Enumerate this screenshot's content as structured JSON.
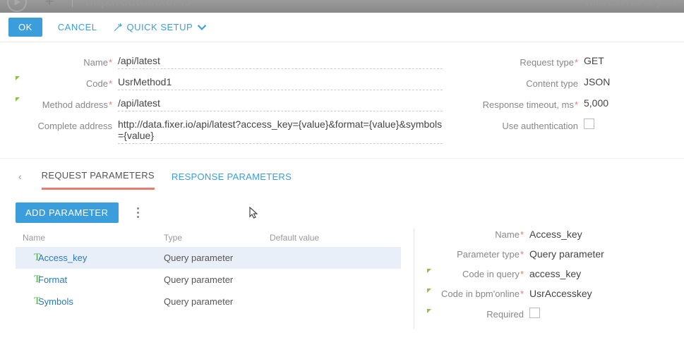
{
  "ribbon": {
    "url": "http://data.fixer.io",
    "search_placeholder": "What can I do for you?"
  },
  "toolbar": {
    "ok": "OK",
    "cancel": "CANCEL",
    "quick": "QUICK SETUP"
  },
  "form": {
    "labels": {
      "name": "Name",
      "code": "Code",
      "method_address": "Method address",
      "complete_address": "Complete address",
      "request_type": "Request type",
      "content_type": "Content type",
      "response_timeout": "Response timeout, ms",
      "use_auth": "Use authentication"
    },
    "values": {
      "name": "/api/latest",
      "code": "UsrMethod1",
      "method_address": "/api/latest",
      "complete_address": "http://data.fixer.io/api/latest?access_key={value}&format={value}&symbols={value}",
      "request_type": "GET",
      "content_type": "JSON",
      "response_timeout": "5,000"
    }
  },
  "tabs": {
    "request": "REQUEST PARAMETERS",
    "response": "RESPONSE PARAMETERS"
  },
  "params": {
    "add_button": "ADD PARAMETER",
    "columns": {
      "name": "Name",
      "type": "Type",
      "default": "Default value"
    },
    "rows": [
      {
        "name": "Access_key",
        "type": "Query parameter",
        "default": ""
      },
      {
        "name": "Format",
        "type": "Query parameter",
        "default": ""
      },
      {
        "name": "Symbols",
        "type": "Query parameter",
        "default": ""
      }
    ]
  },
  "detail": {
    "labels": {
      "name": "Name",
      "param_type": "Parameter type",
      "code_query": "Code in query",
      "code_bpm": "Code in bpm'online",
      "required": "Required"
    },
    "values": {
      "name": "Access_key",
      "param_type": "Query parameter",
      "code_query": "access_key",
      "code_bpm": "UsrAccesskey"
    }
  }
}
